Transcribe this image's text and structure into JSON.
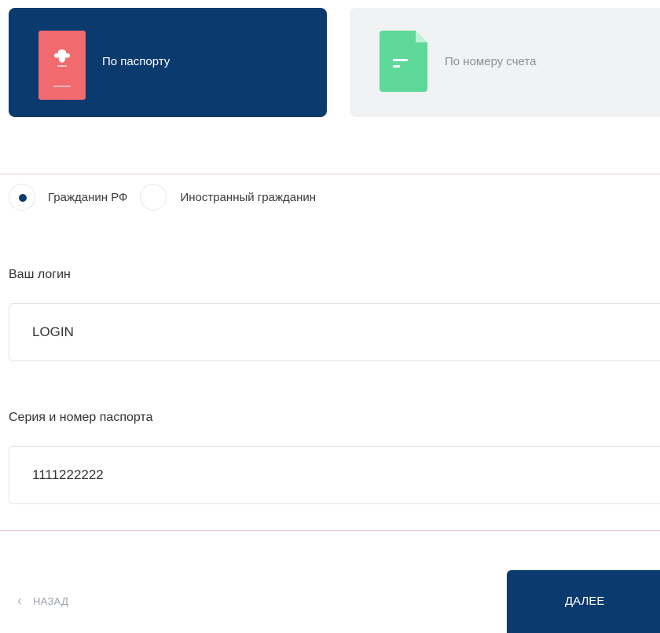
{
  "tabs": {
    "passport": {
      "label": "По паспорту",
      "icon": "passport-emblem-icon",
      "selected": true
    },
    "account": {
      "label": "По номеру счета",
      "icon": "document-icon",
      "selected": false
    }
  },
  "citizenship": {
    "options": [
      {
        "label": "Гражданин РФ",
        "selected": true
      },
      {
        "label": "Иностранный гражданин",
        "selected": false
      }
    ]
  },
  "login": {
    "label": "Ваш логин",
    "value": "LOGIN"
  },
  "passport_number": {
    "label": "Серия и номер паспорта",
    "value": "1111222222"
  },
  "nav": {
    "back_label": "НАЗАД",
    "back_icon": "chevron-left-icon",
    "next_label": "ДАЛЕЕ"
  },
  "colors": {
    "primary": "#0b3a6e",
    "passport_icon": "#f06a6e",
    "document_icon": "#5fd99a",
    "panel_border": "#f1c7d1"
  }
}
